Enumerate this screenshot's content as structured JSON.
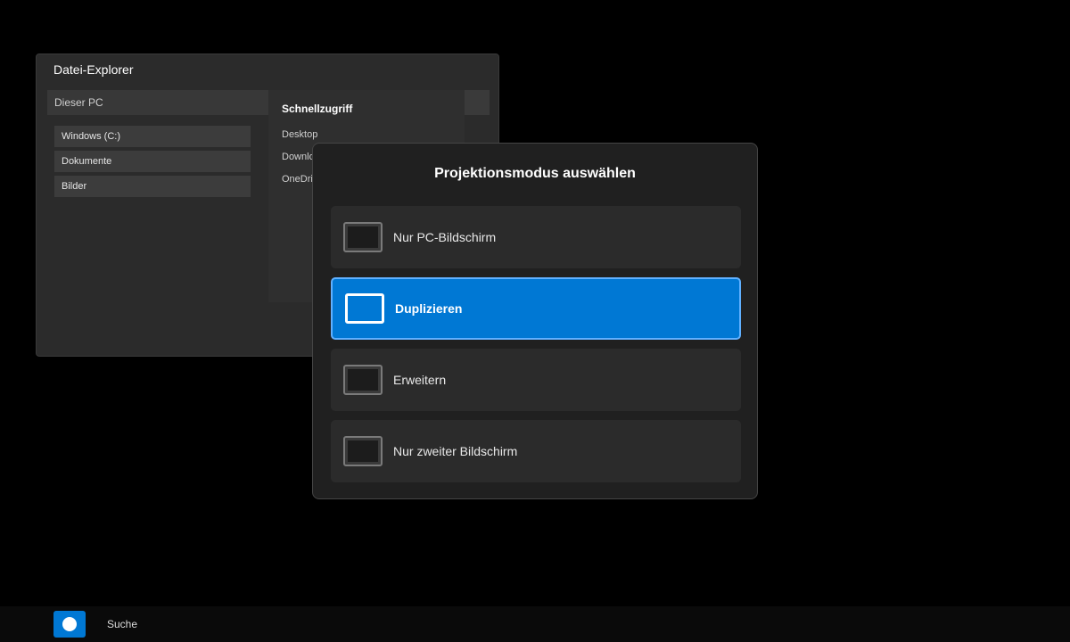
{
  "explorer": {
    "title": "Datei-Explorer",
    "nav_location": "Dieser PC",
    "drives": [
      "Windows (C:)",
      "Dokumente",
      "Bilder"
    ],
    "content": {
      "title": "Schnellzugriff",
      "items": [
        "Desktop",
        "Downloads",
        "OneDrive"
      ]
    }
  },
  "project_panel": {
    "title": "Projektionsmodus auswählen",
    "options": [
      {
        "label": "Nur PC-Bildschirm",
        "selected": false
      },
      {
        "label": "Duplizieren",
        "selected": true
      },
      {
        "label": "Erweitern",
        "selected": false
      },
      {
        "label": "Nur zweiter Bildschirm",
        "selected": false
      }
    ]
  },
  "taskbar": {
    "search_label": "Suche"
  },
  "colors": {
    "accent": "#0078d4",
    "panel_bg": "#202020",
    "option_bg": "#2b2b2b"
  }
}
